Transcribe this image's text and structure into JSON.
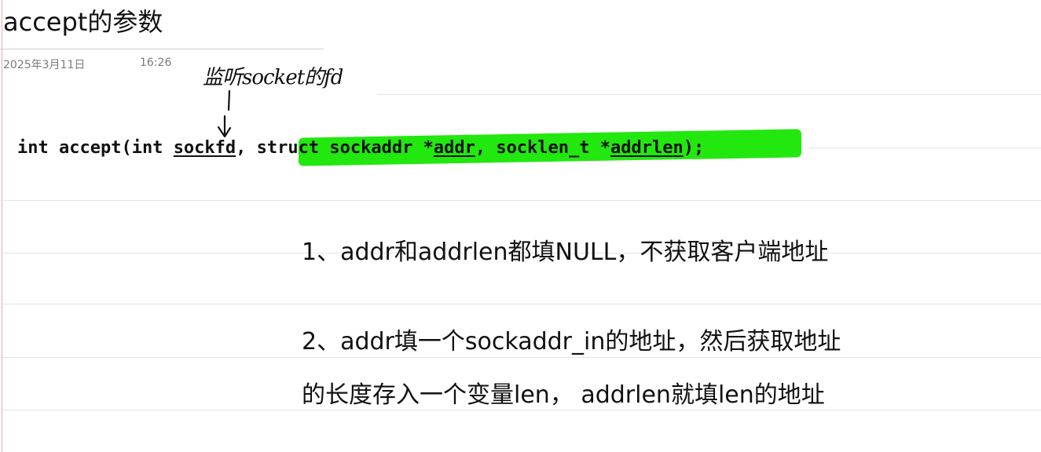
{
  "note": {
    "title": "accept的参数",
    "date": "2025年3月11日",
    "time": "16:26"
  },
  "annotation": {
    "handwritten_text": "监听socket的fd",
    "arrow": "down-arrow"
  },
  "code": {
    "prefix": "int accept(int ",
    "param1": "sockfd",
    "sep1": ", ",
    "hl_part1": "struct sockaddr *",
    "param2": "addr",
    "hl_part2": ", socklen_t *",
    "param3": "addrlen",
    "suffix": ");",
    "highlight_color": "#22e80f"
  },
  "points": {
    "p1": "1、addr和addrlen都填NULL，不获取客户端地址",
    "p2_line1": "2、addr填一个sockaddr_in的地址，然后获取地址",
    "p2_line2": "的长度存入一个变量len， addrlen就填len的地址"
  }
}
